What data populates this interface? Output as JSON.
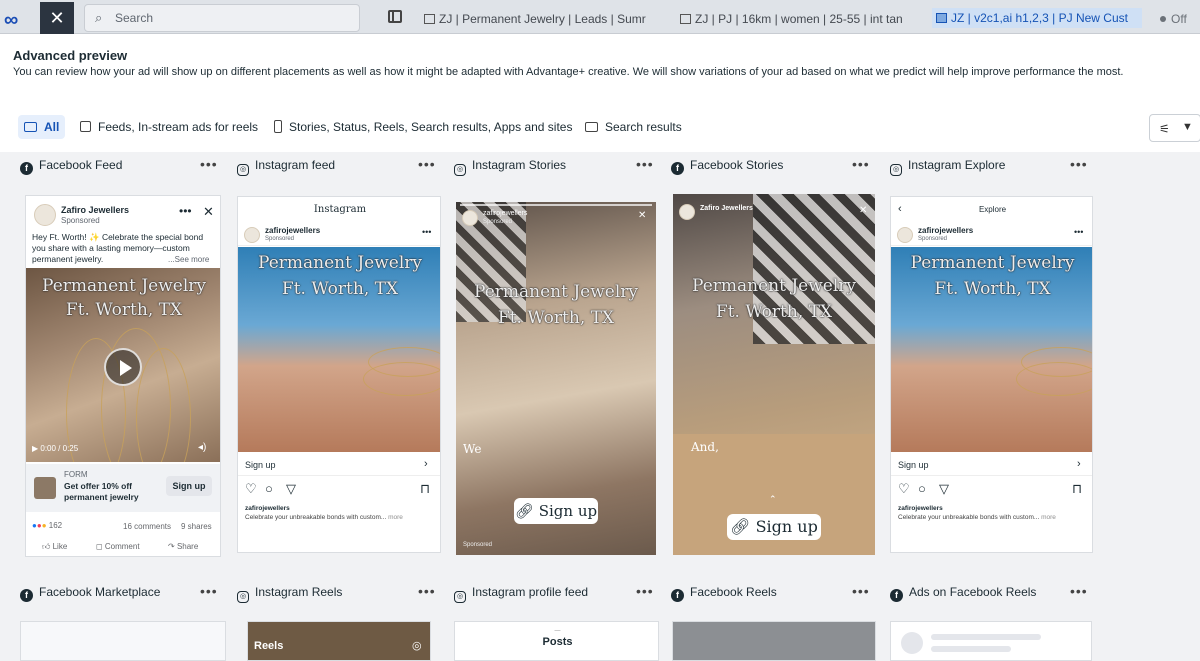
{
  "topbar": {
    "search_placeholder": "Search",
    "tabs": [
      {
        "label": "ZJ | Permanent Jewelry | Leads | Sumr"
      },
      {
        "label": "ZJ | PJ | 16km | women | 25-55 | int tan"
      },
      {
        "label": "JZ | v2c1,ai h1,2,3 | PJ New Cust"
      }
    ],
    "toggle_label": "Off"
  },
  "header": {
    "title": "Advanced preview",
    "description": "You can review how your ad will show up on different placements as well as how it might be adapted with Advantage+ creative. We will show variations of your ad based on what we predict will help improve performance the most."
  },
  "filters": [
    {
      "label": "All",
      "icon": "devices-icon",
      "selected": true
    },
    {
      "label": "Feeds, In-stream ads for reels",
      "icon": "square-icon",
      "selected": false
    },
    {
      "label": "Stories, Status, Reels, Search results, Apps and sites",
      "icon": "phone-icon",
      "selected": false
    },
    {
      "label": "Search results",
      "icon": "rectangle-icon",
      "selected": false
    }
  ],
  "placements_row1": [
    {
      "label": "Facebook Feed",
      "platform": "facebook"
    },
    {
      "label": "Instagram feed",
      "platform": "instagram"
    },
    {
      "label": "Instagram Stories",
      "platform": "instagram"
    },
    {
      "label": "Facebook Stories",
      "platform": "facebook"
    },
    {
      "label": "Instagram Explore",
      "platform": "instagram"
    }
  ],
  "placements_row2": [
    {
      "label": "Facebook Marketplace",
      "platform": "facebook"
    },
    {
      "label": "Instagram Reels",
      "platform": "instagram"
    },
    {
      "label": "Instagram profile feed",
      "platform": "instagram"
    },
    {
      "label": "Facebook Reels",
      "platform": "facebook"
    },
    {
      "label": "Ads on Facebook Reels",
      "platform": "facebook"
    }
  ],
  "ad": {
    "overlay_line1": "Permanent Jewelry",
    "overlay_line2": "Ft. Worth, TX",
    "fb_page": "Zafiro Jewellers",
    "ig_handle": "zafirojewellers",
    "sponsored": "Sponsored",
    "fb_primary_text": "Hey Ft. Worth! ✨ Celebrate the special bond you share with a lasting memory—custom permanent jewelry.",
    "see_more": "...See more",
    "video_time": "0:00 / 0:25",
    "form_label": "FORM",
    "form_headline": "Get offer 10% off permanent jewelry",
    "cta": "Sign up",
    "reaction_count": "162",
    "comments": "16 comments",
    "shares": "9 shares",
    "like": "Like",
    "comment": "Comment",
    "share": "Share",
    "ig_caption": "Celebrate your unbreakable bonds with custom...",
    "ig_more": "more",
    "story_word_ig": "We",
    "story_word_fb": "And,",
    "instagram_logo": "Instagram",
    "explore_title": "Explore",
    "reels_label": "Reels",
    "posts_label": "Posts"
  },
  "colors": {
    "accent": "#1553b5",
    "selected_bg": "#e6effc",
    "canvas": "#f1f2f4"
  }
}
